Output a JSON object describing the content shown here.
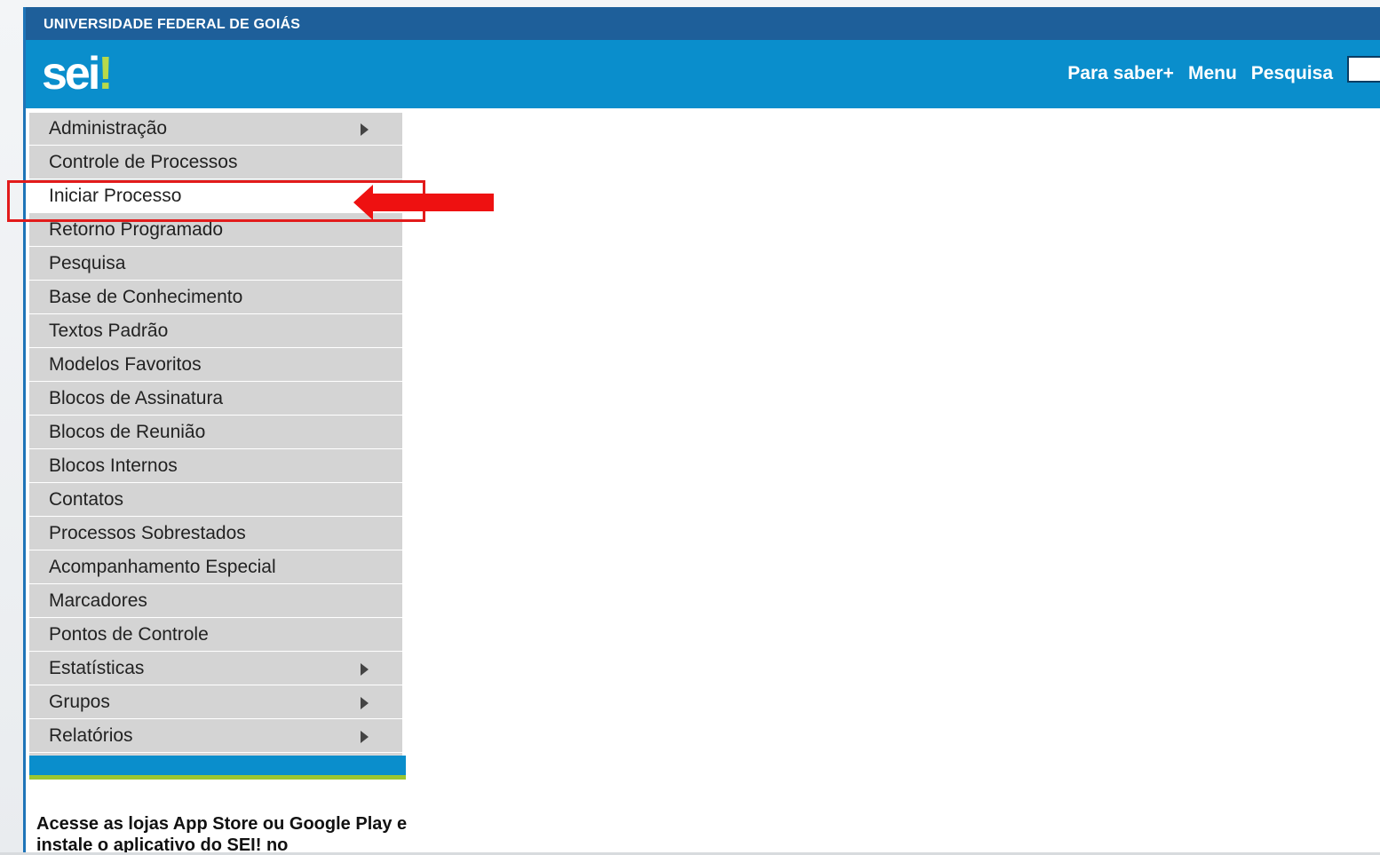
{
  "header": {
    "institution": "UNIVERSIDADE FEDERAL DE GOIÁS",
    "logo_text": "sei",
    "logo_mark": "!",
    "links": [
      "Para saber+",
      "Menu",
      "Pesquisa"
    ]
  },
  "menu": {
    "items": [
      {
        "label": "Administração",
        "submenu": true
      },
      {
        "label": "Controle de Processos",
        "submenu": false
      },
      {
        "label": "Iniciar Processo",
        "submenu": false,
        "highlighted": true
      },
      {
        "label": "Retorno Programado",
        "submenu": false
      },
      {
        "label": "Pesquisa",
        "submenu": false
      },
      {
        "label": "Base de Conhecimento",
        "submenu": false
      },
      {
        "label": "Textos Padrão",
        "submenu": false
      },
      {
        "label": "Modelos Favoritos",
        "submenu": false
      },
      {
        "label": "Blocos de Assinatura",
        "submenu": false
      },
      {
        "label": "Blocos de Reunião",
        "submenu": false
      },
      {
        "label": "Blocos Internos",
        "submenu": false
      },
      {
        "label": "Contatos",
        "submenu": false
      },
      {
        "label": "Processos Sobrestados",
        "submenu": false
      },
      {
        "label": "Acompanhamento Especial",
        "submenu": false
      },
      {
        "label": "Marcadores",
        "submenu": false
      },
      {
        "label": "Pontos de Controle",
        "submenu": false
      },
      {
        "label": "Estatísticas",
        "submenu": true
      },
      {
        "label": "Grupos",
        "submenu": true
      },
      {
        "label": "Relatórios",
        "submenu": true
      }
    ]
  },
  "app_promo": {
    "text": "Acesse as lojas App Store ou Google Play e instale o aplicativo do SEI! no"
  },
  "colors": {
    "top_strip": "#1e5f9a",
    "header": "#0a8ecc",
    "menu_bg": "#d4d4d4",
    "highlight": "#e21b1b",
    "accent_green": "#9cc631"
  }
}
